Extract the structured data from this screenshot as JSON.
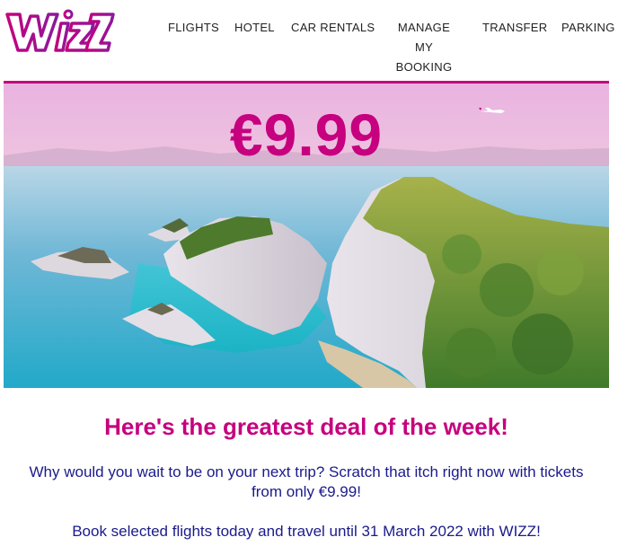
{
  "brand": {
    "logo_text": "WIZZ",
    "colors": {
      "primary": "#c6007e",
      "body_text": "#1a1a8c"
    }
  },
  "nav": {
    "items": [
      {
        "label": "FLIGHTS"
      },
      {
        "label": "HOTEL"
      },
      {
        "label": "CAR RENTALS"
      },
      {
        "label_line1": "MANAGE MY",
        "label_line2": "BOOKING"
      },
      {
        "label": "TRANSFER"
      },
      {
        "label": "PARKING"
      }
    ]
  },
  "hero": {
    "price": "€9.99",
    "image": "coastal-cliff-sea-landscape"
  },
  "content": {
    "headline": "Here's the greatest deal of the week!",
    "paragraph1_line1": "Why would you wait to be on your next trip? Scratch that itch right now with tickets",
    "paragraph1_line2": "from only €9.99!",
    "paragraph2": "Book selected flights today and travel until 31 March 2022 with WIZZ!"
  }
}
